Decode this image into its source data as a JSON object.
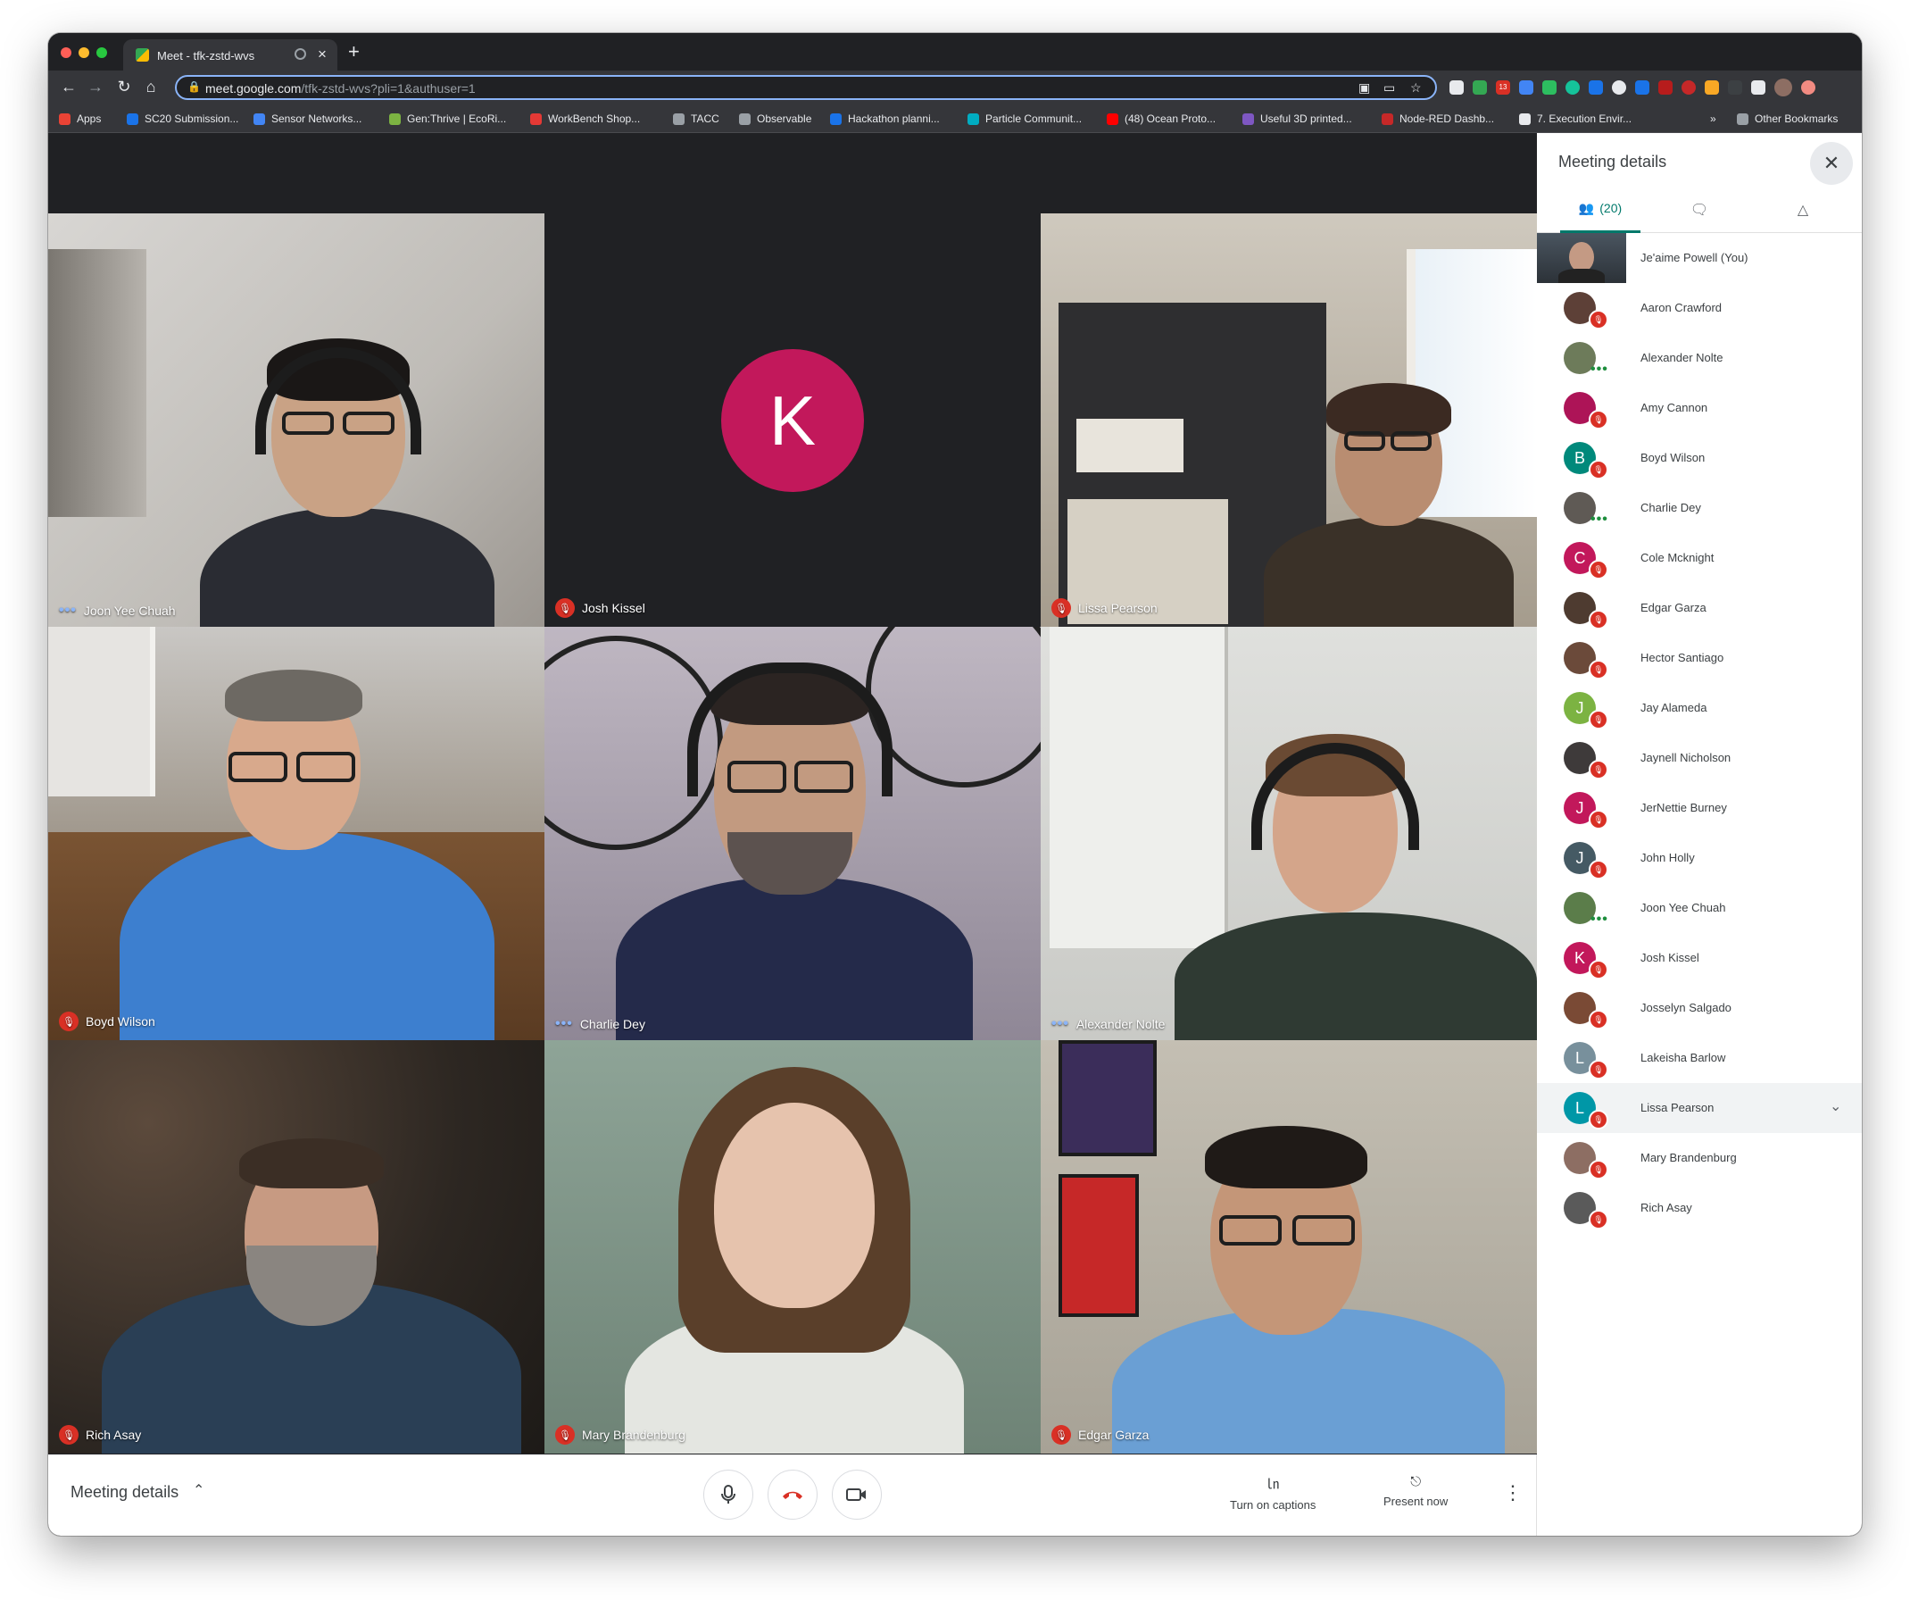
{
  "browser": {
    "tab_title": "Meet - tfk-zstd-wvs",
    "tab_close": "×",
    "new_tab": "+",
    "url_host": "meet.google.com",
    "url_path": "/tfk-zstd-wvs?pli=1&authuser=1",
    "ext_badge": "13"
  },
  "bookmarks": [
    {
      "label": "Apps",
      "color": "#ea4335"
    },
    {
      "label": "SC20 Submission...",
      "color": "#1a73e8"
    },
    {
      "label": "Sensor Networks...",
      "color": "#4285f4"
    },
    {
      "label": "Gen:Thrive | EcoRi...",
      "color": "#7cb342"
    },
    {
      "label": "WorkBench Shop...",
      "color": "#e53935"
    },
    {
      "label": "TACC",
      "color": "#9aa0a6"
    },
    {
      "label": "Observable",
      "color": "#9aa0a6"
    },
    {
      "label": "Hackathon planni...",
      "color": "#1a73e8"
    },
    {
      "label": "Particle Communit...",
      "color": "#00acc1"
    },
    {
      "label": "(48) Ocean Proto...",
      "color": "#ff0000"
    },
    {
      "label": "Useful 3D printed...",
      "color": "#7e57c2"
    },
    {
      "label": "Node-RED Dashb...",
      "color": "#c62828"
    },
    {
      "label": "7. Execution Envir...",
      "color": "#e8eaed"
    }
  ],
  "bookmarks_overflow": "»",
  "other_bookmarks": "Other Bookmarks",
  "tiles": [
    {
      "name": "Joon Yee Chuah",
      "state": "speaking"
    },
    {
      "name": "Josh Kissel",
      "state": "muted",
      "avatar_letter": "K"
    },
    {
      "name": "Lissa Pearson",
      "state": "muted"
    },
    {
      "name": "Boyd Wilson",
      "state": "muted"
    },
    {
      "name": "Charlie Dey",
      "state": "speaking"
    },
    {
      "name": "Alexander Nolte",
      "state": "speaking"
    },
    {
      "name": "Rich Asay",
      "state": "muted"
    },
    {
      "name": "Mary Brandenburg",
      "state": "muted"
    },
    {
      "name": "Edgar Garza",
      "state": "muted"
    }
  ],
  "bottom": {
    "meeting_details": "Meeting details",
    "captions": "Turn on captions",
    "present": "Present now"
  },
  "panel": {
    "title": "Meeting details",
    "people_count": "(20)",
    "participants": [
      {
        "name": "Je'aime Powell (You)",
        "kind": "you"
      },
      {
        "name": "Aaron Crawford",
        "kind": "photo",
        "color": "#5d4037",
        "state": "muted"
      },
      {
        "name": "Alexander Nolte",
        "kind": "photo",
        "color": "#6d7b5a",
        "state": "speaking"
      },
      {
        "name": "Amy Cannon",
        "kind": "photo",
        "color": "#ad1457",
        "state": "muted"
      },
      {
        "name": "Boyd Wilson",
        "kind": "letter",
        "letter": "B",
        "color": "#00897b",
        "state": "muted"
      },
      {
        "name": "Charlie Dey",
        "kind": "photo",
        "color": "#5f5a55",
        "state": "speaking"
      },
      {
        "name": "Cole Mcknight",
        "kind": "letter",
        "letter": "C",
        "color": "#c2185b",
        "state": "muted"
      },
      {
        "name": "Edgar Garza",
        "kind": "photo",
        "color": "#4e3b30",
        "state": "muted"
      },
      {
        "name": "Hector Santiago",
        "kind": "photo",
        "color": "#6b4a3a",
        "state": "muted"
      },
      {
        "name": "Jay Alameda",
        "kind": "letter",
        "letter": "J",
        "color": "#7cb342",
        "state": "muted"
      },
      {
        "name": "Jaynell Nicholson",
        "kind": "photo",
        "color": "#3e3a3a",
        "state": "muted"
      },
      {
        "name": "JerNettie Burney",
        "kind": "letter",
        "letter": "J",
        "color": "#c2185b",
        "state": "muted"
      },
      {
        "name": "John Holly",
        "kind": "letter",
        "letter": "J",
        "color": "#455a64",
        "state": "muted"
      },
      {
        "name": "Joon Yee Chuah",
        "kind": "photo",
        "color": "#5b7d4a",
        "state": "speaking"
      },
      {
        "name": "Josh Kissel",
        "kind": "letter",
        "letter": "K",
        "color": "#c2185b",
        "state": "muted"
      },
      {
        "name": "Josselyn Salgado",
        "kind": "photo",
        "color": "#7a4a35",
        "state": "muted"
      },
      {
        "name": "Lakeisha Barlow",
        "kind": "letter",
        "letter": "L",
        "color": "#78909c",
        "state": "muted"
      },
      {
        "name": "Lissa Pearson",
        "kind": "letter",
        "letter": "L",
        "color": "#0097a7",
        "state": "muted",
        "hover": true
      },
      {
        "name": "Mary Brandenburg",
        "kind": "photo",
        "color": "#8d6e63",
        "state": "muted"
      },
      {
        "name": "Rich Asay",
        "kind": "photo",
        "color": "#5a5a5a",
        "state": "muted"
      }
    ]
  }
}
